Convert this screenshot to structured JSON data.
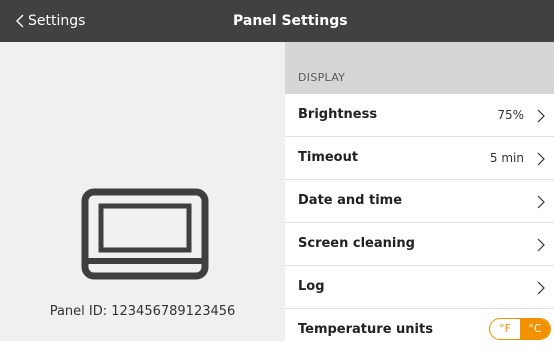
{
  "colors": {
    "header_bg": "#414141",
    "accent": "#f39200",
    "section_bg": "#d6d6d6",
    "left_bg": "#f0f0f0"
  },
  "header": {
    "back_label": "Settings",
    "back_icon": "chevron-left-icon",
    "title": "Panel Settings"
  },
  "left": {
    "device_icon": "panel-device-icon",
    "panel_id_text": "Panel ID: 123456789123456"
  },
  "display": {
    "section_label": "DISPLAY",
    "rows": [
      {
        "label": "Brightness",
        "value": "75%"
      },
      {
        "label": "Timeout",
        "value": "5 min"
      },
      {
        "label": "Date and time"
      },
      {
        "label": "Screen cleaning"
      },
      {
        "label": "Log"
      },
      {
        "label": "Temperature units"
      }
    ],
    "temperature": {
      "fahrenheit": "°F",
      "celsius": "°C",
      "selected": "°C"
    }
  }
}
